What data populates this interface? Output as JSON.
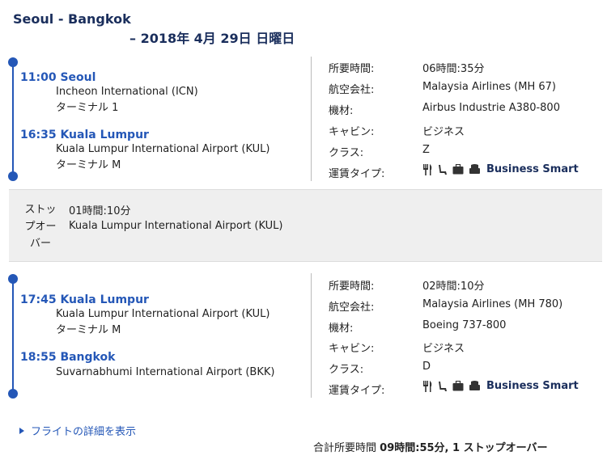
{
  "header": {
    "route": "Seoul - Bangkok",
    "date": "– 2018年 4月 29日 日曜日"
  },
  "segments": [
    {
      "departure": {
        "time_city": "11:00 Seoul",
        "airport": "Incheon International (ICN)",
        "terminal": "ターミナル 1"
      },
      "arrival": {
        "time_city": "16:35 Kuala Lumpur",
        "airport": "Kuala Lumpur International Airport (KUL)",
        "terminal": "ターミナル M"
      },
      "details": {
        "duration_label": "所要時間:",
        "duration": "06時間:35分",
        "airline_label": "航空会社:",
        "airline": "Malaysia Airlines (MH 67)",
        "aircraft_label": "機材:",
        "aircraft": "Airbus Industrie A380-800",
        "cabin_label": "キャビン:",
        "cabin": "ビジネス",
        "class_label": "クラス:",
        "class": "Z",
        "fare_label": "運賃タイプ:",
        "fare": "Business Smart"
      }
    },
    {
      "departure": {
        "time_city": "17:45 Kuala Lumpur",
        "airport": "Kuala Lumpur International Airport (KUL)",
        "terminal": "ターミナル M"
      },
      "arrival": {
        "time_city": "18:55 Bangkok",
        "airport": "Suvarnabhumi International Airport (BKK)",
        "terminal": ""
      },
      "details": {
        "duration_label": "所要時間:",
        "duration": "02時間:10分",
        "airline_label": "航空会社:",
        "airline": "Malaysia Airlines (MH 780)",
        "aircraft_label": "機材:",
        "aircraft": "Boeing 737-800",
        "cabin_label": "キャビン:",
        "cabin": "ビジネス",
        "class_label": "クラス:",
        "class": "D",
        "fare_label": "運賃タイプ:",
        "fare": "Business Smart"
      }
    }
  ],
  "stopover": {
    "label": "ストッ\nプオー\nバー",
    "duration": "01時間:10分",
    "airport": "Kuala Lumpur International Airport (KUL)"
  },
  "footer": {
    "details_link": "フライトの詳細を表示",
    "total_label": "合計所要時間",
    "total_value": "09時間:55分, 1 ストップオーバー"
  },
  "colors": {
    "accent": "#2457b7",
    "title": "#1a2e5c",
    "stopover_bg": "#efefef"
  },
  "fare_icons": [
    "meal-icon",
    "seat-icon",
    "baggage-icon",
    "lounge-icon"
  ]
}
